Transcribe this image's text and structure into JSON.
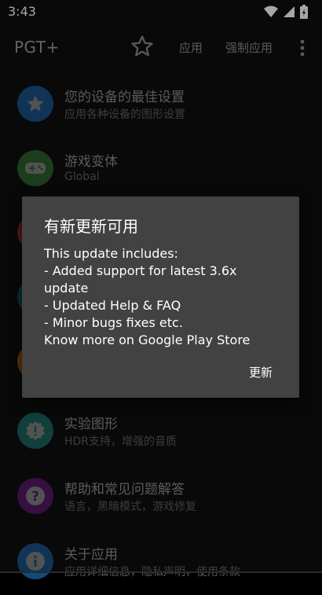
{
  "status_bar": {
    "time": "3:43"
  },
  "app_bar": {
    "title": "PGT+",
    "action_apply": "应用",
    "action_force_apply": "强制应用"
  },
  "list": {
    "items": [
      {
        "title": "您的设备的最佳设置",
        "subtitle": "应用各种设备的图形设置",
        "icon": "star-icon",
        "color": "#1e88e5"
      },
      {
        "title": "游戏变体",
        "subtitle": "Global",
        "icon": "gamepad-icon",
        "color": "#43a047"
      },
      {
        "title": "",
        "subtitle": "",
        "icon": "red-circle",
        "color": "#e53935"
      },
      {
        "title": "",
        "subtitle": "",
        "icon": "teal-circle",
        "color": "#00897b"
      },
      {
        "title": "",
        "subtitle": "",
        "icon": "orange-circle",
        "color": "#fb8c00"
      },
      {
        "title": "实验图形",
        "subtitle": "HDR支持，增强的音质",
        "icon": "alert-badge-icon",
        "color": "#26a69a"
      },
      {
        "title": "帮助和常见问题解答",
        "subtitle": "语言，黑暗模式，游戏修复",
        "icon": "help-icon",
        "color": "#8e24aa"
      },
      {
        "title": "关于应用",
        "subtitle": "应用详细信息，隐私声明，使用条款",
        "icon": "info-icon",
        "color": "#1e88e5"
      }
    ]
  },
  "dialog": {
    "title": "有新更新可用",
    "lines": [
      "This update includes:",
      "- Added support for latest 3.6x",
      "update",
      "- Updated Help & FAQ",
      "- Minor bugs fixes etc.",
      "Know more on Google Play Store"
    ],
    "button": "更新"
  }
}
